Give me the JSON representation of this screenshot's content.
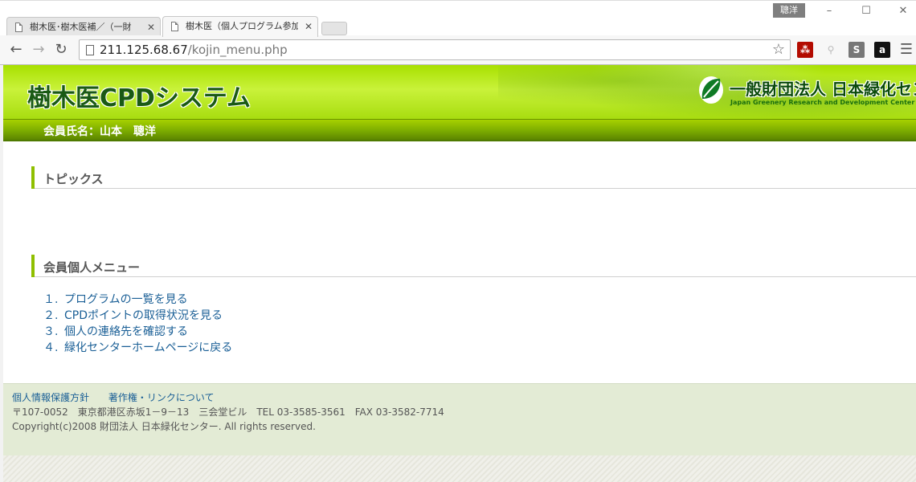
{
  "browser": {
    "user_badge": "聰洋",
    "tabs": [
      {
        "label": "樹木医･樹木医補／（一財",
        "close": "✕"
      },
      {
        "label": "樹木医（個人プログラム参加",
        "close": "✕"
      }
    ],
    "url_host": "211.125.68.67",
    "url_path": "/kojin_menu.php"
  },
  "header": {
    "site_title": "樹木医CPDシステム",
    "org_name": "一般財団法人 日本緑化センター",
    "org_name_en": "Japan Greenery Research and Development Center"
  },
  "member_bar": {
    "text": "会員氏名：山本　聰洋"
  },
  "topics": {
    "heading": "トピックス"
  },
  "member_menu": {
    "heading": "会員個人メニュー",
    "items": [
      {
        "num": "１.",
        "label": "プログラムの一覧を見る"
      },
      {
        "num": "２.",
        "label": "CPDポイントの取得状況を見る"
      },
      {
        "num": "３.",
        "label": "個人の連絡先を確認する"
      },
      {
        "num": "４.",
        "label": "緑化センターホームページに戻る"
      }
    ]
  },
  "footer": {
    "privacy_link": "個人情報保護方針",
    "copyright_link": "著作権・リンクについて",
    "address": "〒107-0052　東京都港区赤坂1－9－13　三会堂ビル　TEL 03-3585-3561　FAX 03-3582-7714",
    "copyright": "Copyright(c)2008 財団法人 日本緑化センター. All rights reserved."
  }
}
